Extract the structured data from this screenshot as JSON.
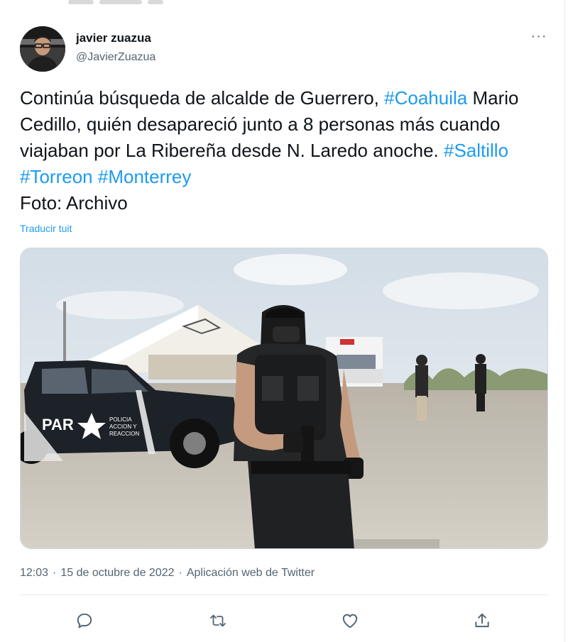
{
  "tweet": {
    "author_name": "javier zuazua",
    "author_handle": "@JavierZuazua",
    "more_icon": "more-horizontal-icon",
    "text_segments": [
      {
        "text": "Continúa búsqueda de alcalde de Guerrero, ",
        "type": "text"
      },
      {
        "text": "#Coahuila",
        "type": "hashtag"
      },
      {
        "text": " Mario Cedillo, quién desapareció junto a 8 personas más cuando viajaban por La Ribereña desde N. Laredo anoche. ",
        "type": "text"
      },
      {
        "text": "#Saltillo",
        "type": "hashtag"
      },
      {
        "text": " ",
        "type": "text"
      },
      {
        "text": "#Torreon",
        "type": "hashtag"
      },
      {
        "text": " ",
        "type": "text"
      },
      {
        "text": "#Monterrey",
        "type": "hashtag"
      }
    ],
    "text_line2": "Foto: Archivo",
    "translate_label": "Traducir tuit",
    "photo": {
      "vehicle_text": "PAR",
      "vehicle_subtext": "POLICIA ACCION Y REACCION",
      "icon": "photo-police-checkpoint"
    },
    "time": "12:03",
    "date": "15 de octubre de 2022",
    "source": "Aplicación web de Twitter",
    "separator": "·",
    "actions": [
      {
        "name": "reply",
        "icon": "reply-icon"
      },
      {
        "name": "retweet",
        "icon": "retweet-icon"
      },
      {
        "name": "like",
        "icon": "heart-icon"
      },
      {
        "name": "share",
        "icon": "share-icon"
      }
    ]
  },
  "colors": {
    "accent": "#1d9bf0",
    "secondary_text": "#536471",
    "text": "#0f1419"
  }
}
